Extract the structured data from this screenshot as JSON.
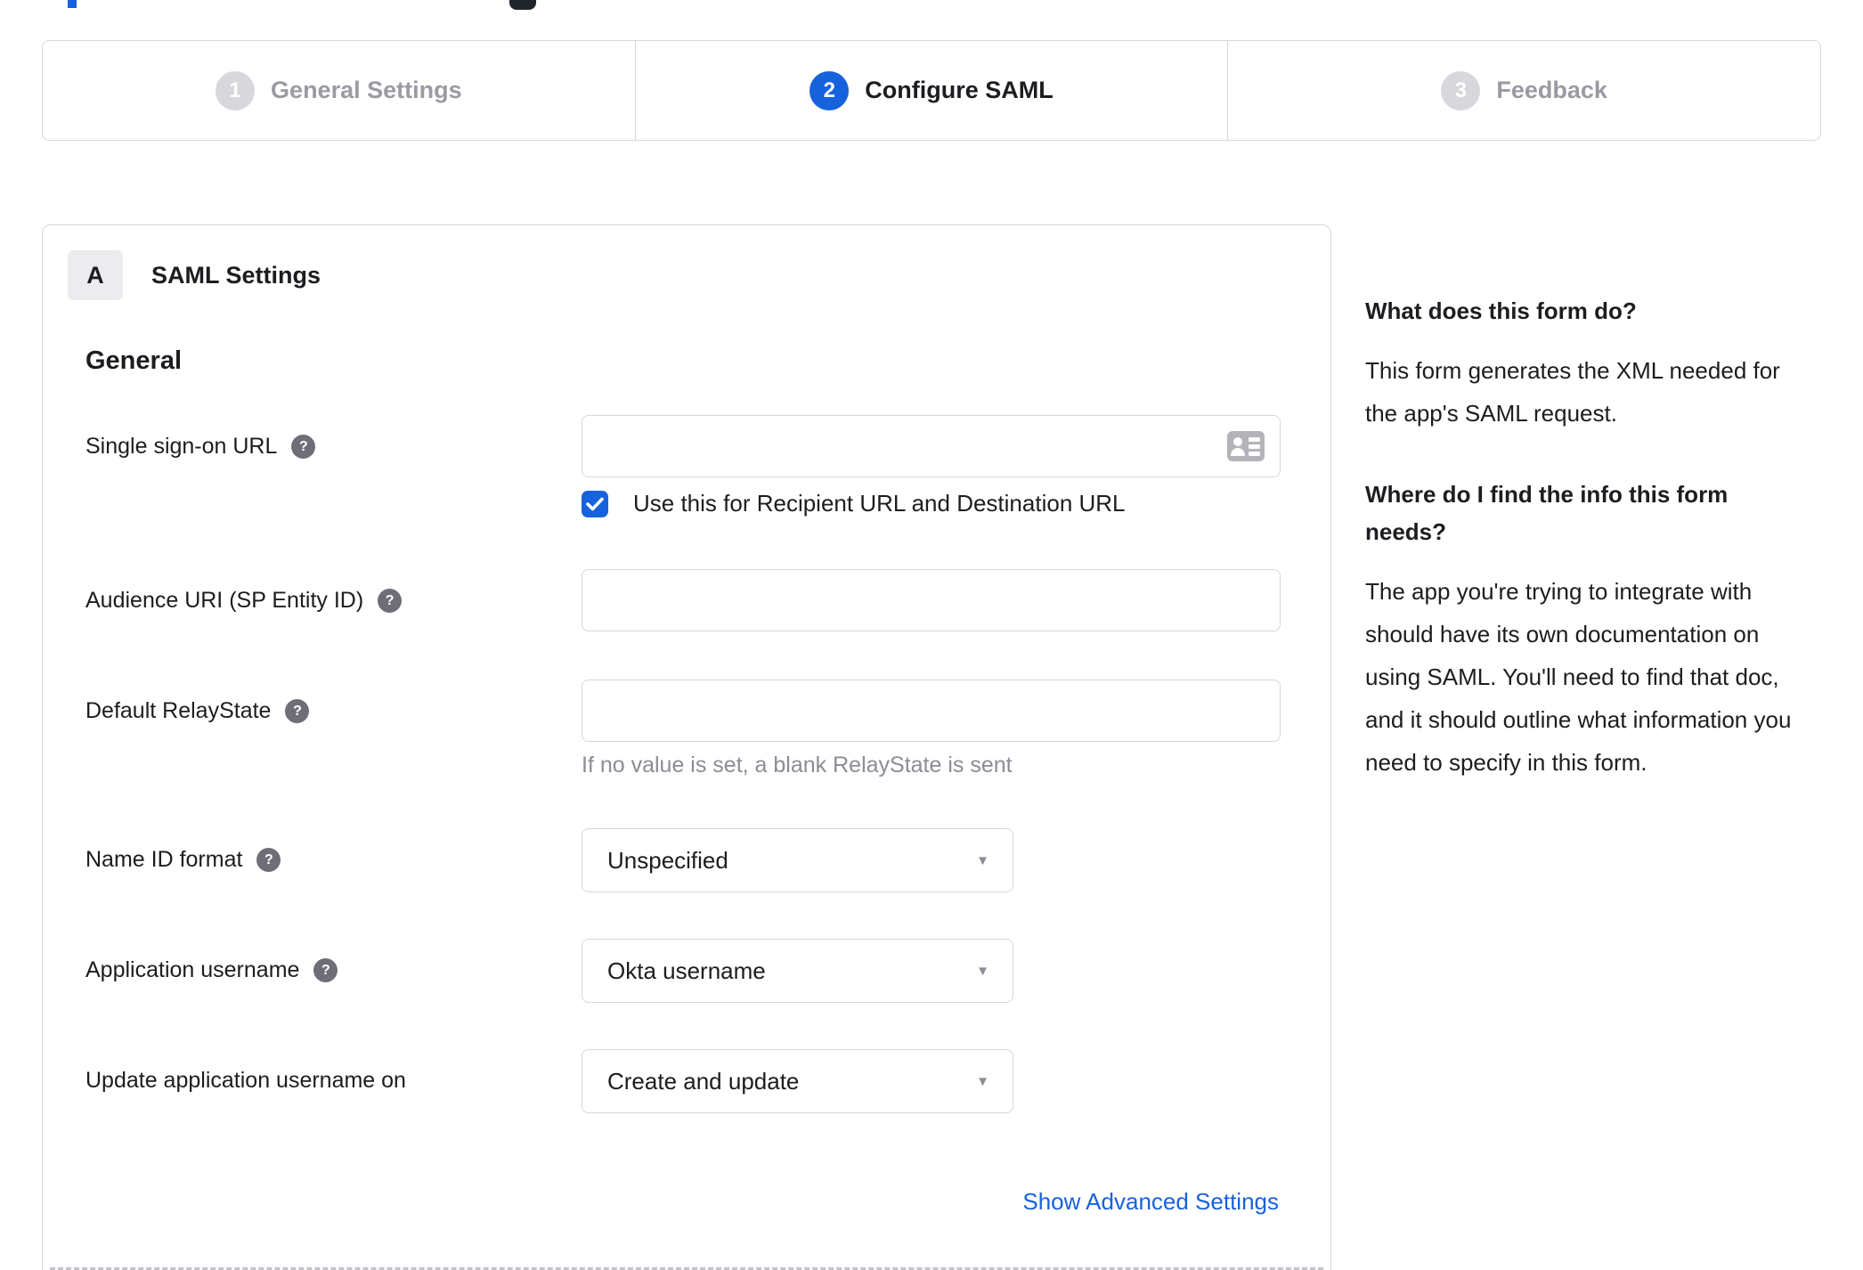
{
  "stepper": {
    "steps": [
      {
        "number": "1",
        "label": "General Settings",
        "state": "inactive"
      },
      {
        "number": "2",
        "label": "Configure SAML",
        "state": "active"
      },
      {
        "number": "3",
        "label": "Feedback",
        "state": "inactive"
      }
    ]
  },
  "panel": {
    "badge": "A",
    "title": "SAML Settings",
    "section_heading": "General",
    "advanced_link": "Show Advanced Settings"
  },
  "fields": {
    "sso": {
      "label": "Single sign-on URL",
      "value": "",
      "placeholder": "",
      "checkbox_checked": true,
      "checkbox_label": "Use this for Recipient URL and Destination URL"
    },
    "audience": {
      "label": "Audience URI (SP Entity ID)",
      "value": "",
      "placeholder": ""
    },
    "relay": {
      "label": "Default RelayState",
      "value": "",
      "placeholder": "",
      "hint": "If no value is set, a blank RelayState is sent"
    },
    "nameid": {
      "label": "Name ID format",
      "value": "Unspecified"
    },
    "appuser": {
      "label": "Application username",
      "value": "Okta username"
    },
    "update": {
      "label": "Update application username on",
      "value": "Create and update"
    }
  },
  "sidebar": {
    "q1": "What does this form do?",
    "a1": "This form generates the XML needed for the app's SAML request.",
    "q2": "Where do I find the info this form needs?",
    "a2": "The app you're trying to integrate with should have its own documentation on using SAML. You'll need to find that doc, and it should outline what information you need to specify in this form."
  },
  "icons": {
    "help": "?",
    "caret": "▼"
  },
  "colors": {
    "accent_blue": "#1662dd",
    "inactive_gray": "#d7d7dc",
    "inactive_text": "#9a9aa3",
    "text_dark": "#1d1d21",
    "hint_gray": "#8c8c96",
    "border": "#d7d7dc",
    "help_icon_bg": "#6e6e78"
  }
}
